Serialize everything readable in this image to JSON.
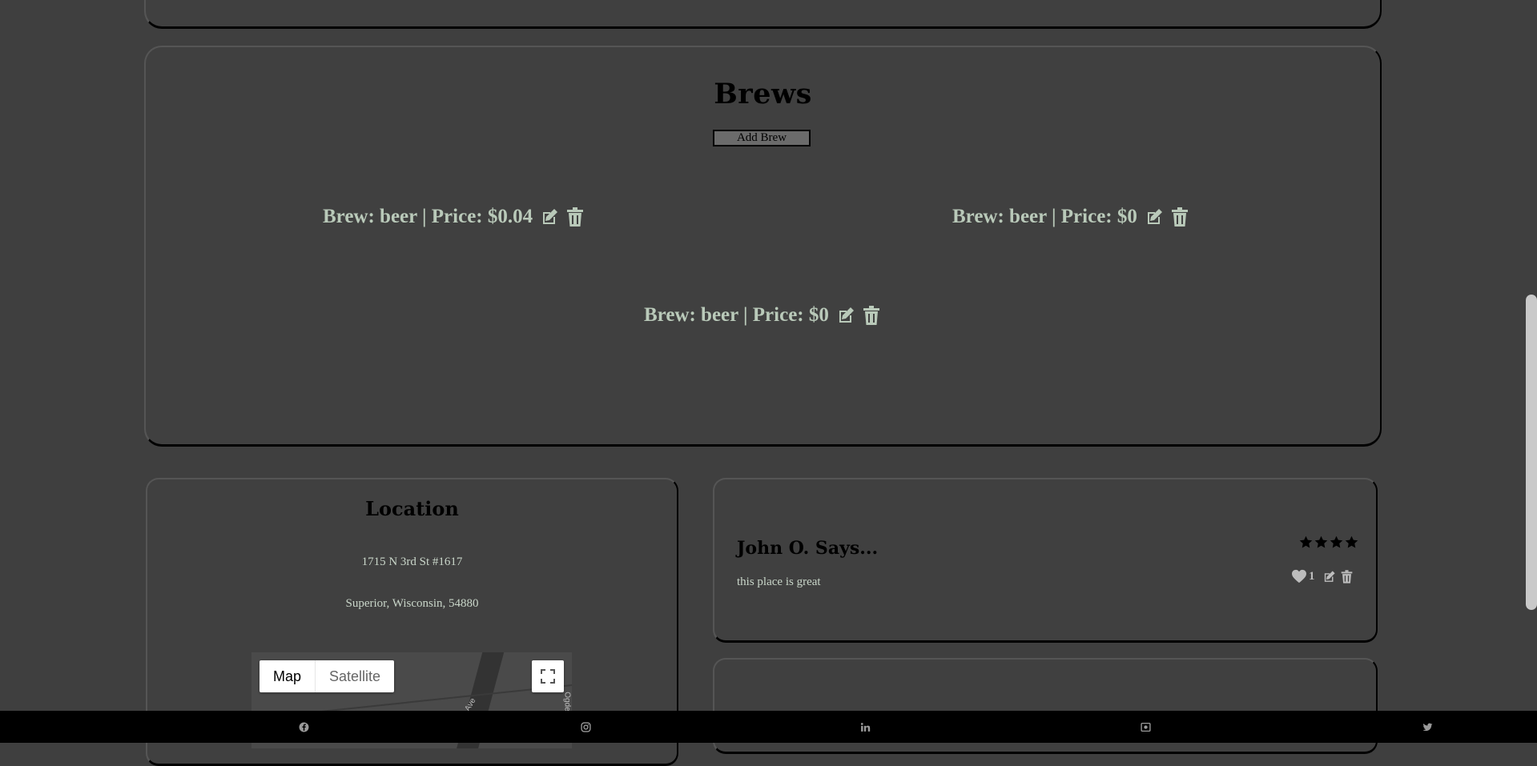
{
  "brews": {
    "title": "Brews",
    "add_button": "Add Brew",
    "items": [
      {
        "label": "Brew: beer | Price: $0.04"
      },
      {
        "label": "Brew: beer | Price: $0"
      },
      {
        "label": "Brew: beer | Price: $0"
      }
    ]
  },
  "location": {
    "title": "Location",
    "address_line1": "1715 N 3rd St #1617",
    "address_line2": "Superior, Wisconsin, 54880",
    "map": {
      "map_label": "Map",
      "satellite_label": "Satellite",
      "street_label_1": "Ave",
      "street_label_2": "Ogde"
    }
  },
  "reviews": [
    {
      "author": "John O. Says...",
      "text": "this place is great",
      "stars": 4,
      "likes": "1"
    }
  ],
  "footer": {
    "icons": [
      "facebook-icon",
      "instagram-icon",
      "linkedin-icon",
      "portfolio-icon",
      "twitter-icon"
    ]
  },
  "colors": {
    "background": "#3f3f3f",
    "text_light": "#b9c9b9",
    "footer": "#000000"
  }
}
